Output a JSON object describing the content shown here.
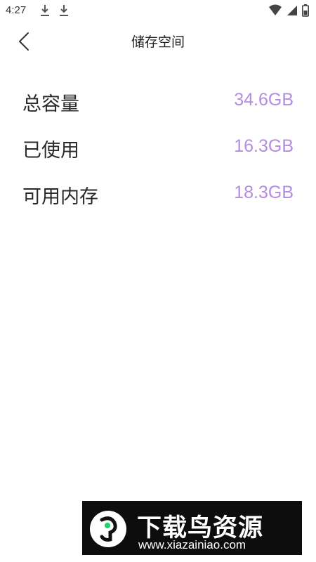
{
  "status_bar": {
    "time": "4:27",
    "icons": [
      "download-icon",
      "download-icon",
      "wifi-icon",
      "cell-signal-icon",
      "battery-icon"
    ]
  },
  "header": {
    "title": "储存空间",
    "back_icon": "chevron-left-icon"
  },
  "storage": {
    "rows": [
      {
        "label": "总容量",
        "value": "34.6GB"
      },
      {
        "label": "已使用",
        "value": "16.3GB"
      },
      {
        "label": "可用内存",
        "value": "18.3GB"
      }
    ]
  },
  "watermark": {
    "brand": "下载鸟资源",
    "url": "www.xiazainiao.com"
  },
  "colors": {
    "accent": "#b58be3",
    "text": "#2a2a2a",
    "background": "#ffffff"
  }
}
